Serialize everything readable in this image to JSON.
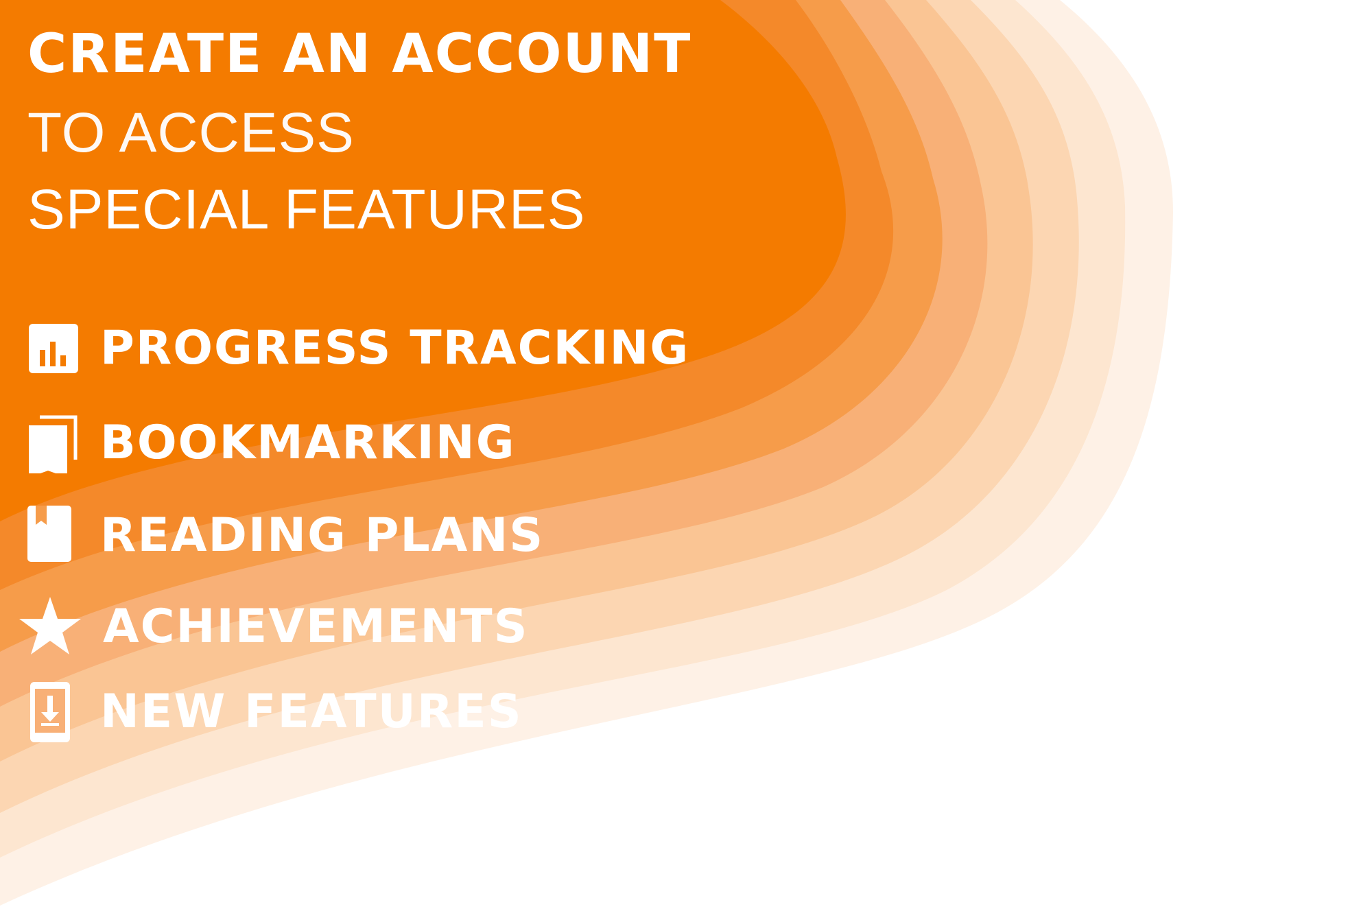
{
  "colors": {
    "accent": "#F47B00",
    "text": "#FFFFFF",
    "bands": [
      "#F47B00",
      "#F4892A",
      "#F69C4A",
      "#F8B077",
      "#FAC594",
      "#FCD6B2",
      "#FDE6D0",
      "#FEF1E6"
    ]
  },
  "header": {
    "line1": "CREATE AN ACCOUNT",
    "line2": "TO ACCESS",
    "line3": "SPECIAL FEATURES"
  },
  "features": [
    {
      "label": "PROGRESS TRACKING",
      "icon": "bar-chart-icon"
    },
    {
      "label": "BOOKMARKING",
      "icon": "bookmark-icon"
    },
    {
      "label": "READING PLANS",
      "icon": "book-icon"
    },
    {
      "label": "ACHIEVEMENTS",
      "icon": "star-icon"
    },
    {
      "label": "NEW FEATURES",
      "icon": "download-device-icon"
    }
  ]
}
